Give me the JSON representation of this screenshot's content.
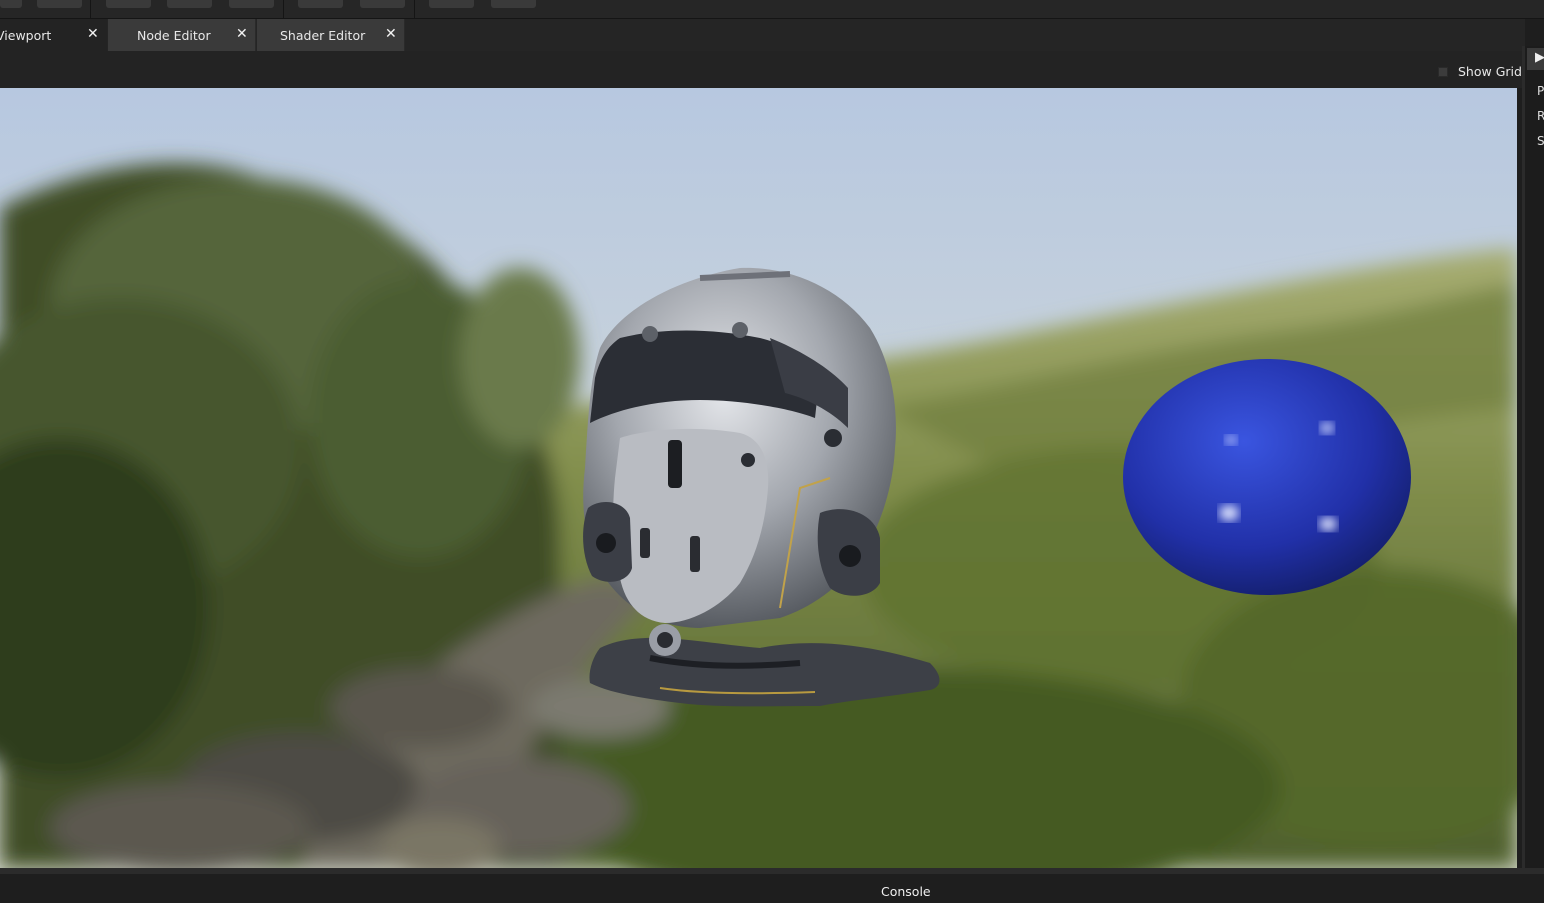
{
  "tabs": [
    {
      "label": "Viewport",
      "close": "✕"
    },
    {
      "label": "Node Editor",
      "close": "✕"
    },
    {
      "label": "Shader Editor",
      "close": "✕"
    }
  ],
  "viewport": {
    "show_grid_label": "Show Grid",
    "show_grid_checked": false
  },
  "right_panel": {
    "expand_arrow": "▶",
    "items": [
      "P",
      "R",
      "S"
    ]
  },
  "console": {
    "label": "Console"
  },
  "colors": {
    "panel_bg": "#1e1e1e",
    "tab_inactive": "#3a3a3a",
    "sphere": "#2336b8"
  }
}
